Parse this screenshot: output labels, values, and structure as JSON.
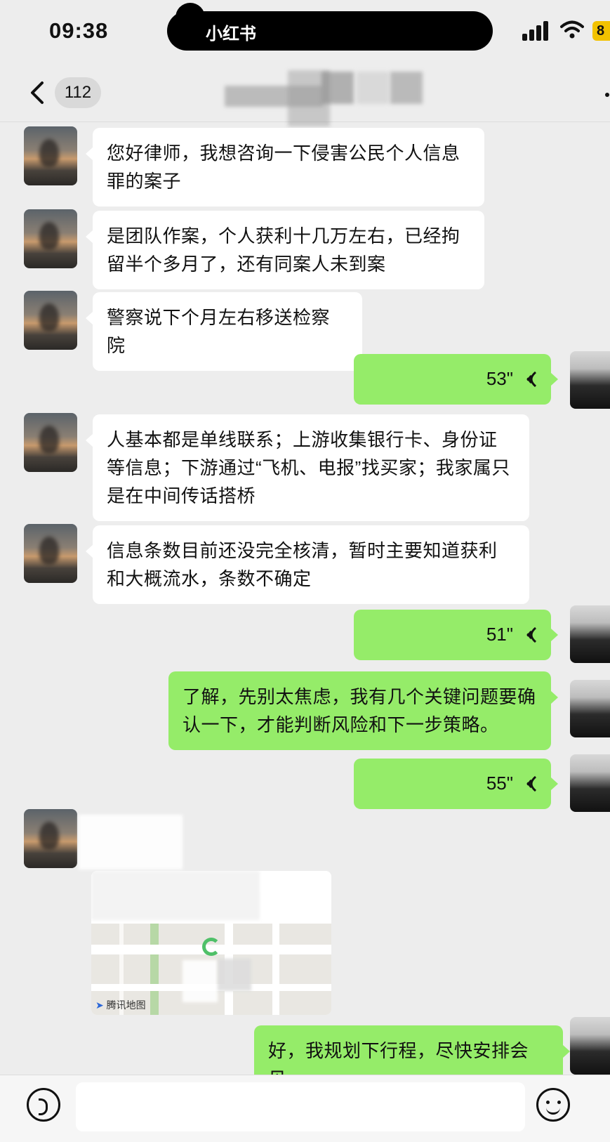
{
  "status_bar": {
    "time": "09:38",
    "source_app": "小红书",
    "battery": "8"
  },
  "nav": {
    "unread_count": "112"
  },
  "messages": [
    {
      "text": "您好律师，我想咨询一下侵害公民个人信息罪的案子"
    },
    {
      "text": "是团队作案，个人获利十几万左右，已经拘留半个多月了，还有同案人未到案"
    },
    {
      "text": "警察说下个月左右移送检察院"
    },
    {
      "duration": "53\""
    },
    {
      "text": "人基本都是单线联系；上游收集银行卡、身份证等信息；下游通过“飞机、电报”找买家；我家属只是在中间传话搭桥"
    },
    {
      "text": "信息条数目前还没完全核清，暂时主要知道获利和大概流水，条数不确定"
    },
    {
      "duration": "51\""
    },
    {
      "text": "了解，先别太焦虑，我有几个关键问题要确认一下，才能判断风险和下一步策略。"
    },
    {
      "duration": "55\""
    },
    {
      "map_brand": "腾讯地图"
    },
    {
      "text": "好，我规划下行程，尽快安排会见。"
    }
  ],
  "colors": {
    "outgoing_bubble": "#95ec69",
    "incoming_bubble": "#ffffff",
    "background": "#ededed"
  }
}
